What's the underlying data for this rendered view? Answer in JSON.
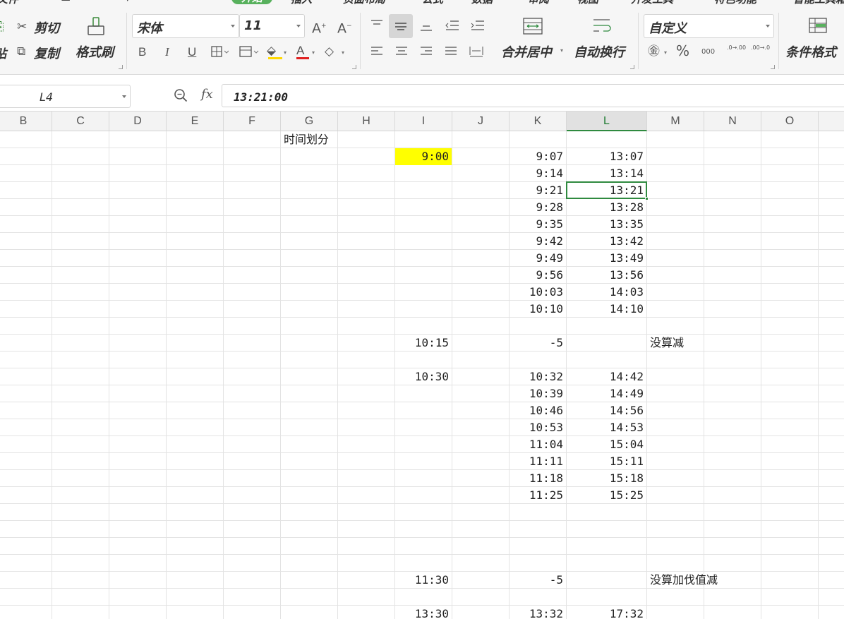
{
  "ribbon": {
    "tabs": [
      "文件",
      "开始",
      "插入",
      "页面布局",
      "公式",
      "数据",
      "审阅",
      "视图",
      "开发工具",
      "特色功能",
      "智能工具箱"
    ],
    "active_tab": "开始",
    "clipboard": {
      "cut": "剪切",
      "copy": "复制",
      "paste_partial": "贴",
      "format_painter": "格式刷"
    },
    "font": {
      "name": "宋体",
      "size": "11",
      "bold": "B",
      "italic": "I",
      "underline": "U",
      "font_color_glyph": "A",
      "grow_glyph": "A",
      "shrink_glyph": "A"
    },
    "alignment": {
      "merge_center": "合并居中",
      "wrap_text": "自动换行"
    },
    "number": {
      "format": "自定义",
      "percent": "%",
      "thousands": "000",
      "inc_decimal": ".0→.00",
      "dec_decimal": ".00→.0"
    },
    "styles": {
      "conditional_format": "条件格式"
    },
    "colors": {
      "fill_color": "#ffd800",
      "font_color": "#e02020",
      "accent": "#58b15d"
    }
  },
  "formula_bar": {
    "name_box": "L4",
    "fx": "fx",
    "content": "13:21:00"
  },
  "grid": {
    "columns": [
      "B",
      "C",
      "D",
      "E",
      "F",
      "G",
      "H",
      "I",
      "J",
      "K",
      "L",
      "M",
      "N",
      "O"
    ],
    "selected_column": "L",
    "active_cell": "L4",
    "cells": [
      {
        "ref": "G2",
        "value": "时间划分"
      },
      {
        "ref": "I3",
        "value": "9:00",
        "highlight": "#ffff00"
      },
      {
        "ref": "K3",
        "value": "9:07"
      },
      {
        "ref": "L3",
        "value": "13:07"
      },
      {
        "ref": "K4",
        "value": "9:14"
      },
      {
        "ref": "L4",
        "value": "13:14"
      },
      {
        "ref": "K5",
        "value": "9:21"
      },
      {
        "ref": "L5",
        "value": "13:21"
      },
      {
        "ref": "K6",
        "value": "9:28"
      },
      {
        "ref": "L6",
        "value": "13:28"
      },
      {
        "ref": "K7",
        "value": "9:35"
      },
      {
        "ref": "L7",
        "value": "13:35"
      },
      {
        "ref": "K8",
        "value": "9:42"
      },
      {
        "ref": "L8",
        "value": "13:42"
      },
      {
        "ref": "K9",
        "value": "9:49"
      },
      {
        "ref": "L9",
        "value": "13:49"
      },
      {
        "ref": "K10",
        "value": "9:56"
      },
      {
        "ref": "L10",
        "value": "13:56"
      },
      {
        "ref": "K11",
        "value": "10:03"
      },
      {
        "ref": "L11",
        "value": "14:03"
      },
      {
        "ref": "K12",
        "value": "10:10"
      },
      {
        "ref": "L12",
        "value": "14:10"
      },
      {
        "ref": "I14",
        "value": "10:15"
      },
      {
        "ref": "K14",
        "value": "-5"
      },
      {
        "ref": "M14",
        "value": "没算减"
      },
      {
        "ref": "I16",
        "value": "10:30"
      },
      {
        "ref": "K16",
        "value": "10:32"
      },
      {
        "ref": "L16",
        "value": "14:42"
      },
      {
        "ref": "K17",
        "value": "10:39"
      },
      {
        "ref": "L17",
        "value": "14:49"
      },
      {
        "ref": "K18",
        "value": "10:46"
      },
      {
        "ref": "L18",
        "value": "14:56"
      },
      {
        "ref": "K19",
        "value": "10:53"
      },
      {
        "ref": "L19",
        "value": "14:53"
      },
      {
        "ref": "K20",
        "value": "11:04"
      },
      {
        "ref": "L20",
        "value": "15:04"
      },
      {
        "ref": "K21",
        "value": "11:11"
      },
      {
        "ref": "L21",
        "value": "15:11"
      },
      {
        "ref": "K22",
        "value": "11:18"
      },
      {
        "ref": "L22",
        "value": "15:18"
      },
      {
        "ref": "K23",
        "value": "11:25"
      },
      {
        "ref": "L23",
        "value": "15:25"
      },
      {
        "ref": "I28",
        "value": "11:30"
      },
      {
        "ref": "K28",
        "value": "-5"
      },
      {
        "ref": "M28",
        "value": "没算加伐值减"
      },
      {
        "ref": "I30",
        "value": "13:30"
      },
      {
        "ref": "K30",
        "value": "13:32"
      },
      {
        "ref": "L30",
        "value": "17:32"
      }
    ]
  }
}
